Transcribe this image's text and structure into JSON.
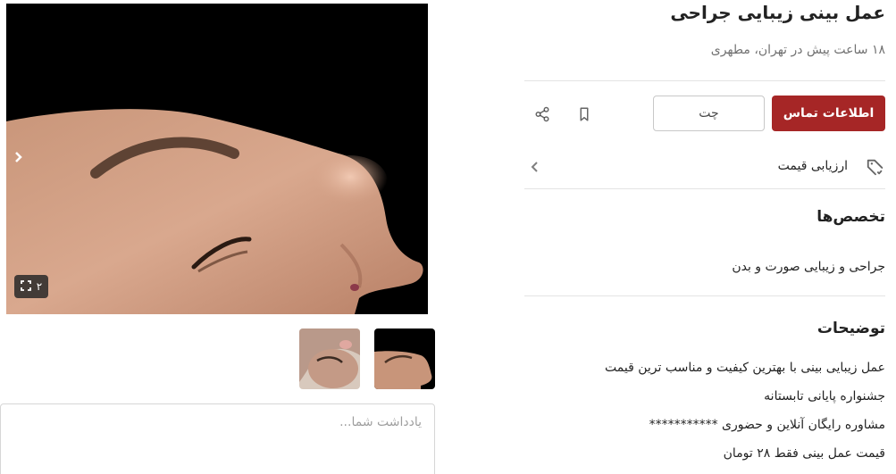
{
  "post": {
    "title": "عمل بینی زیبایی جراحی",
    "subtitle": "۱۸ ساعت پیش در تهران، مطهری"
  },
  "actions": {
    "contact_label": "اطلاعات تماس",
    "chat_label": "چت",
    "bookmark_icon": "bookmark-icon",
    "share_icon": "share-icon"
  },
  "price_evaluation": {
    "label": "ارزیابی قیمت",
    "icon": "price-tag-check-icon"
  },
  "specialties": {
    "title": "تخصص‌ها",
    "value": "جراحی و زیبایی صورت و بدن"
  },
  "description": {
    "title": "توضیحات",
    "lines": [
      "عمل زیبایی بینی با بهترین کیفیت و مناسب ترین قیمت",
      "جشنواره پایانی تابستانه",
      "مشاوره رایگان آنلاین و حضوری ***********",
      "قیمت عمل بینی فقط ۲۸ تومان"
    ]
  },
  "gallery": {
    "image_count": "۲",
    "thumbnails": [
      "thumbnail-1",
      "thumbnail-2"
    ]
  },
  "note": {
    "placeholder": "یادداشت شما..."
  },
  "colors": {
    "primary": "#a62626",
    "image_background": "#000000"
  }
}
